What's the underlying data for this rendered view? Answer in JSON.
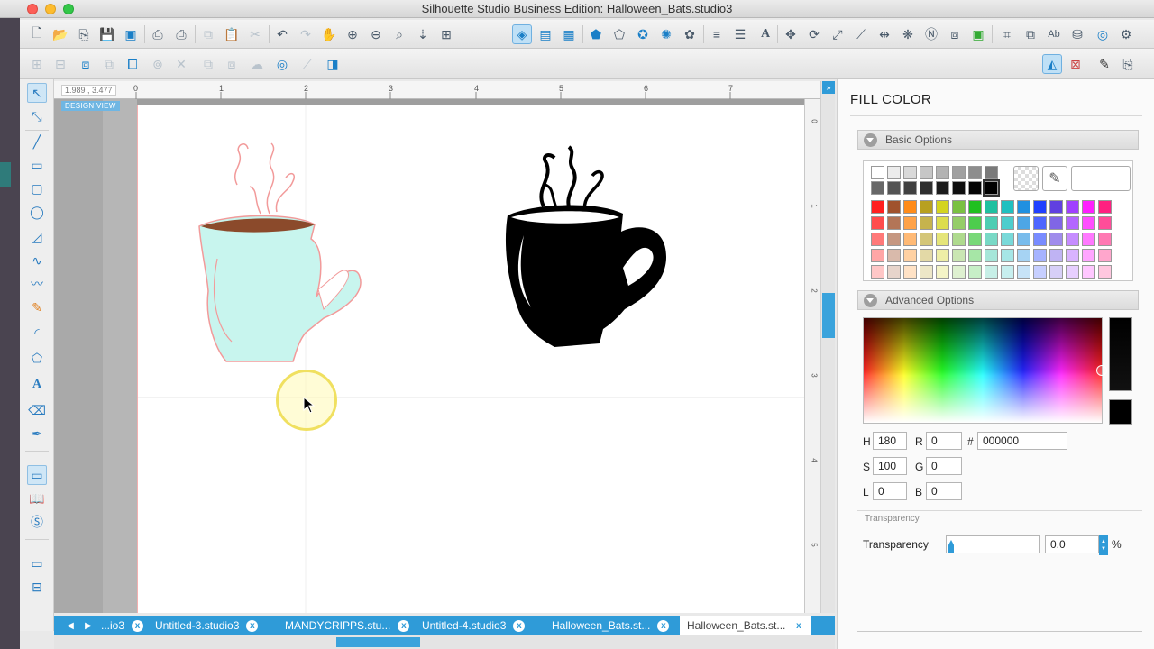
{
  "window": {
    "title": "Silhouette Studio Business Edition: Halloween_Bats.studio3"
  },
  "canvas": {
    "coords": "1.989 , 3.477",
    "design_view_label": "DESIGN VIEW",
    "ruler_top_numbers": [
      "0",
      "1",
      "2",
      "3",
      "4",
      "5",
      "6",
      "7"
    ],
    "ruler_right_numbers": [
      "0",
      "1",
      "2",
      "3",
      "4",
      "5"
    ]
  },
  "tabs": [
    {
      "label": "...io3"
    },
    {
      "label": "Untitled-3.studio3"
    },
    {
      "label": "MANDYCRIPPS.stu..."
    },
    {
      "label": "Untitled-4.studio3"
    },
    {
      "label": "Halloween_Bats.st..."
    },
    {
      "label": "Halloween_Bats.st..."
    }
  ],
  "tab_close_glyph": "x",
  "panel": {
    "title": "FILL COLOR",
    "basic_options": "Basic Options",
    "advanced_options": "Advanced Options",
    "fields": {
      "h_label": "H",
      "h_value": "180",
      "s_label": "S",
      "s_value": "100",
      "l_label": "L",
      "l_value": "0",
      "r_label": "R",
      "r_value": "0",
      "g_label": "G",
      "g_value": "0",
      "b_label": "B",
      "b_value": "0",
      "hex_label": "#",
      "hex_value": "000000"
    },
    "transparency_header": "Transparency",
    "transparency_label": "Transparency",
    "transparency_value": "0.0",
    "transparency_unit": "%"
  },
  "colors": {
    "accent": "#2f9bd8",
    "mug_fill": "#c8f5ee",
    "mug_outline": "#f29a9a",
    "mug_liquid": "#8b4a2b",
    "black_mug": "#000000"
  }
}
